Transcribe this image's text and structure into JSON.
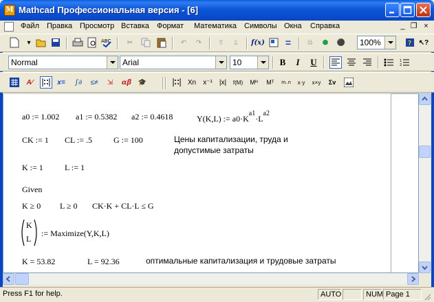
{
  "window": {
    "title": "Mathcad Профессиональная версия - [6]",
    "app_icon_glyph": "M"
  },
  "menu": [
    "Файл",
    "Правка",
    "Просмотр",
    "Вставка",
    "Формат",
    "Математика",
    "Символы",
    "Окна",
    "Справка"
  ],
  "toolbar": {
    "zoom": "100%"
  },
  "format_bar": {
    "style": "Normal",
    "font": "Arial",
    "size": "10",
    "bold": "B",
    "italic": "I",
    "underline": "U"
  },
  "math_bar": {
    "alpha_beta": "αβ",
    "x_equals": "x="
  },
  "calc_bar": {
    "sub": "Xn",
    "sup": "x⁻¹",
    "abs": "|x|",
    "func": "f(M)",
    "msup": "Mᴴ",
    "mt": "Mᵀ",
    "range": "m..n",
    "dot": "x·y",
    "cross": "x×y",
    "sigma": "Σv"
  },
  "document": {
    "line1": {
      "a0": "a0 := 1.002",
      "a1": "a1 := 0.5382",
      "a2": "a2 := 0.4618",
      "Y_lhs": "Y(K,L) := a0·K",
      "Y_exp1": "a1",
      "Y_mid": "·L",
      "Y_exp2": "a2"
    },
    "line2": {
      "CK": "CK := 1",
      "CL": "CL := .5",
      "G": "G := 100",
      "comment1": "Цены капитализации, труда и",
      "comment2": "допустимые затраты"
    },
    "line3": {
      "K": "K := 1",
      "L": "L := 1"
    },
    "given": "Given",
    "constraints": {
      "c1": "K ≥ 0",
      "c2": "L ≥ 0",
      "c3": "CK·K + CL·L ≤ G"
    },
    "maximize": {
      "vK": "K",
      "vL": "L",
      "expr": ":= Maximize(Y,K,L)"
    },
    "result": {
      "K": "K = 53.82",
      "L": "L = 92.36",
      "comment": "оптимальные капитализация и трудовые затраты"
    }
  },
  "status": {
    "help": "Press F1 for help.",
    "auto": "AUTO",
    "num": "NUM",
    "page": "Page 1"
  }
}
